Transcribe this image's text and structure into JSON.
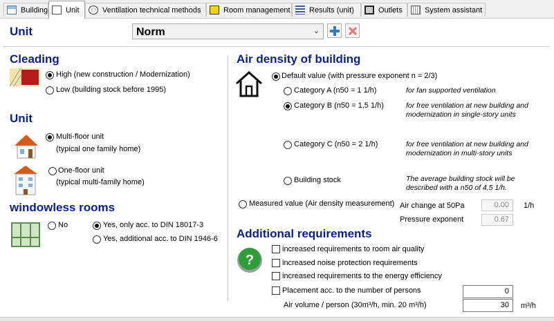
{
  "tabs": [
    {
      "label": "Building",
      "icon": "building-icon"
    },
    {
      "label": "Unit",
      "icon": "house-icon",
      "active": true
    },
    {
      "label": "Ventilation technical methods",
      "icon": "ventilation-icon"
    },
    {
      "label": "Room management",
      "icon": "room-icon"
    },
    {
      "label": "Results (unit)",
      "icon": "results-list-icon"
    },
    {
      "label": "Outlets",
      "icon": "outlets-icon"
    },
    {
      "label": "System assistant",
      "icon": "assistant-icon"
    }
  ],
  "header": {
    "title": "Unit",
    "selected_unit": "Norm",
    "add_icon": "plus-icon",
    "delete_icon": "delete-x-icon"
  },
  "cleading": {
    "title": "Cleading",
    "options": [
      "High (new construction / Modernization)",
      "Low (building stock before 1995)"
    ],
    "selected": 0
  },
  "unit": {
    "title": "Unit",
    "multi_floor": {
      "label": "Multi-floor unit",
      "sub": "(typical one family home)",
      "selected": true
    },
    "one_floor": {
      "label": "One-floor unit",
      "sub": "(typical multi-family home)",
      "selected": false
    }
  },
  "windowless": {
    "title": "windowless rooms",
    "options": [
      "No",
      "Yes, only acc. to DIN 18017-3",
      "Yes, additional acc. to DIN 1946-6"
    ],
    "selected": 1
  },
  "air_density": {
    "title": "Air density of building",
    "default_label": "Default value (with pressure exponent n = 2/3)",
    "categories": [
      {
        "label": "Category A (n50 = 1 1/h)",
        "desc": "for fan supported ventilation"
      },
      {
        "label": "Category B (n50 = 1,5 1/h)",
        "desc": "for free ventilation at new building and modernization in single-story units"
      },
      {
        "label": "Category C (n50 = 2 1/h)",
        "desc": "for free ventilation at new building and modernization in multi-story units"
      },
      {
        "label": "Building stock",
        "desc": "The average building stock will be described with a n50 of 4,5 1/h."
      }
    ],
    "selected_category": 1,
    "measured_label": "Measured value (Air density measurement)",
    "air_change_label": "Air change at 50Pa",
    "air_change_value": "0.00",
    "air_change_unit": "1/h",
    "pressure_exp_label": "Pressure exponent",
    "pressure_exp_value": "0.67"
  },
  "additional": {
    "title": "Additional requirements",
    "checks": [
      "increased requirements to room air quality",
      "increased noise protection requirements",
      "increased requirements to the energy efficiency",
      "Placement acc. to the number of persons"
    ],
    "persons_value": "0",
    "air_volume_label": "Air volume / person (30m³/h, min. 20 m³/h)",
    "air_volume_value": "30",
    "air_volume_unit": "m³/h",
    "help_icon": "question-mark-icon"
  }
}
